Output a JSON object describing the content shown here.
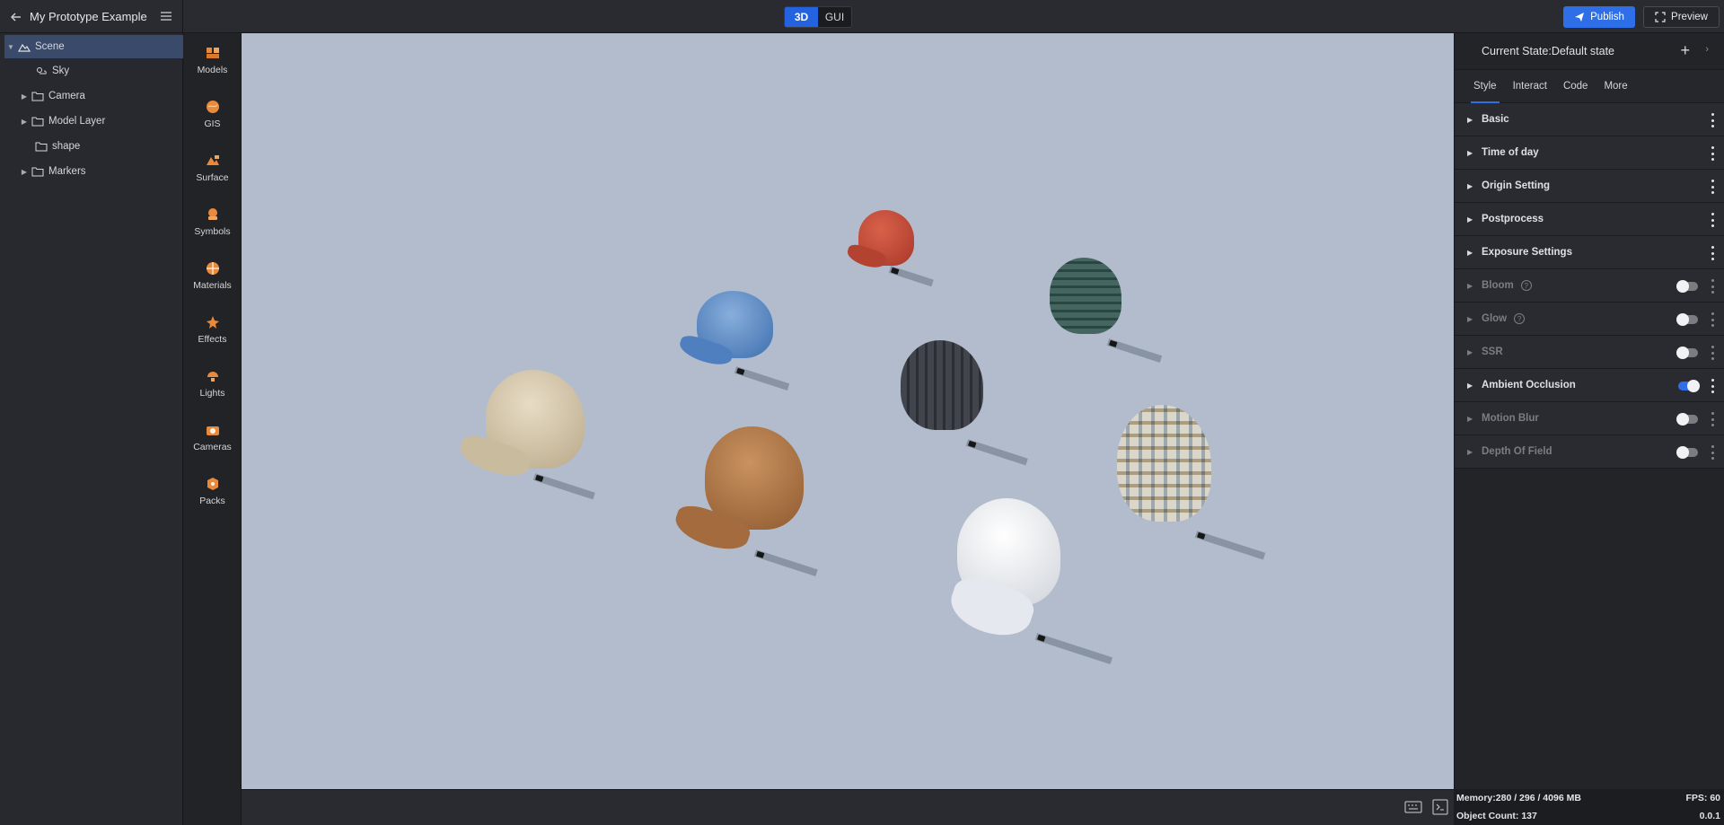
{
  "header": {
    "project_title": "My Prototype Example",
    "mode_3d": "3D",
    "mode_gui": "GUI",
    "publish_label": "Publish",
    "preview_label": "Preview"
  },
  "scene_tree": {
    "items": [
      {
        "label": "Scene",
        "icon": "scene-icon",
        "expanded": true
      },
      {
        "label": "Sky",
        "icon": "sky-icon"
      },
      {
        "label": "Camera",
        "icon": "folder-icon"
      },
      {
        "label": "Model Layer",
        "icon": "folder-icon"
      },
      {
        "label": "shape",
        "icon": "folder-icon"
      },
      {
        "label": "Markers",
        "icon": "folder-icon"
      }
    ]
  },
  "assets": {
    "items": [
      {
        "label": "Models",
        "icon": "models-icon"
      },
      {
        "label": "GIS",
        "icon": "gis-icon"
      },
      {
        "label": "Surface",
        "icon": "surface-icon"
      },
      {
        "label": "Symbols",
        "icon": "symbols-icon"
      },
      {
        "label": "Materials",
        "icon": "materials-icon"
      },
      {
        "label": "Effects",
        "icon": "effects-icon"
      },
      {
        "label": "Lights",
        "icon": "lights-icon"
      },
      {
        "label": "Cameras",
        "icon": "cameras-icon"
      },
      {
        "label": "Packs",
        "icon": "packs-icon"
      }
    ]
  },
  "inspector": {
    "current_state": "Current State:Default state",
    "tabs": [
      "Style",
      "Interact",
      "Code",
      "More"
    ],
    "sections": [
      {
        "title": "Basic"
      },
      {
        "title": "Time of day"
      },
      {
        "title": "Origin Setting"
      },
      {
        "title": "Postprocess"
      },
      {
        "title": "Exposure Settings"
      },
      {
        "title": "Bloom"
      },
      {
        "title": "Glow"
      },
      {
        "title": "SSR"
      },
      {
        "title": "Ambient Occlusion"
      },
      {
        "title": "Motion Blur"
      },
      {
        "title": "Depth Of Field"
      }
    ]
  },
  "stats": {
    "memory": "Memory:280 / 296 / 4096 MB",
    "fps": "FPS: 60",
    "object_count": "Object Count: 137",
    "version": "0.0.1"
  },
  "colors": {
    "accent": "#2f6ee6",
    "viewport_bg": "#b2bccd",
    "panel_bg": "#232428"
  }
}
